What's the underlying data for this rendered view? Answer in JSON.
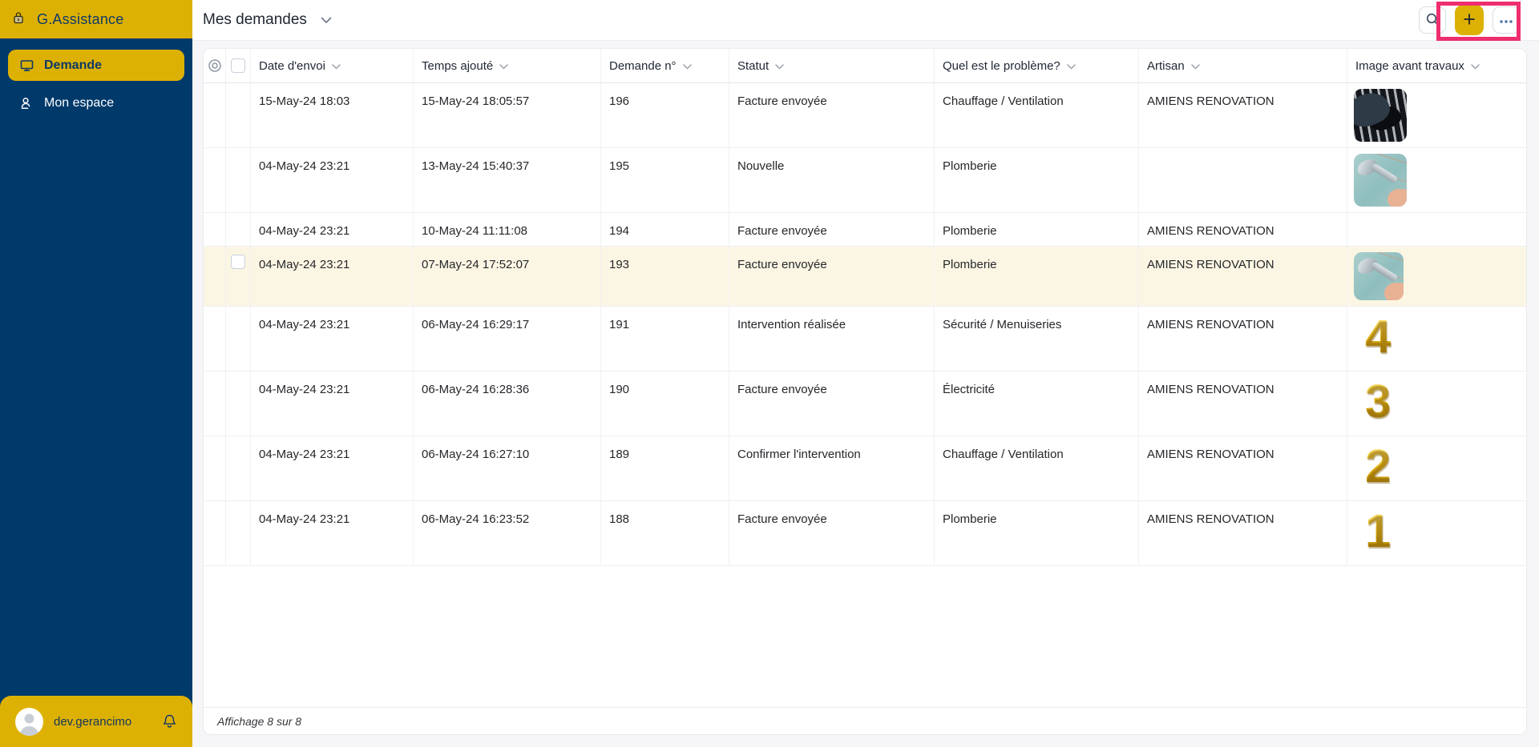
{
  "app": {
    "brand": "G.Assistance"
  },
  "colors": {
    "brand_yellow": "#DDB104",
    "sidebar_blue": "#003A6B",
    "annotation_pink": "#EE2E6E",
    "row_highlight": "#FBF6E3"
  },
  "sidebar": {
    "brand_icon": "padlock-icon",
    "items": [
      {
        "label": "Demande",
        "icon": "monitor-icon",
        "active": true
      },
      {
        "label": "Mon espace",
        "icon": "user-icon",
        "active": false
      }
    ],
    "user": {
      "name": "dev.gerancimo",
      "icons": [
        "avatar",
        "bell-icon"
      ]
    }
  },
  "topbar": {
    "title": "Mes demandes",
    "title_icon": "chevron-down-icon",
    "actions": [
      {
        "name": "search",
        "icon": "search-icon"
      },
      {
        "name": "add",
        "icon": "plus-icon"
      },
      {
        "name": "more",
        "icon": "ellipsis-icon"
      }
    ]
  },
  "annotation": {
    "shape": "highlight-rectangle",
    "color": "#EE2E6E"
  },
  "table": {
    "tools": {
      "watch_icon": "watch-all-icon",
      "select_all": "checkbox"
    },
    "columns": [
      {
        "label": "Date d'envoi",
        "sort_icon": "chevron-down-icon"
      },
      {
        "label": "Temps ajouté",
        "sort_icon": "chevron-down-icon"
      },
      {
        "label": "Demande n°",
        "sort_icon": "chevron-down-icon"
      },
      {
        "label": "Statut",
        "sort_icon": "chevron-down-icon"
      },
      {
        "label": "Quel est le problème?",
        "sort_icon": "chevron-down-icon"
      },
      {
        "label": "Artisan",
        "sort_icon": "chevron-down-icon"
      },
      {
        "label": "Image avant travaux",
        "sort_icon": "chevron-down-icon"
      }
    ],
    "rows": [
      {
        "date": "15-May-24 18:03",
        "time_added": "15-May-24 18:05:57",
        "number": "196",
        "status": "Facture envoyée",
        "problem": "Chauffage / Ventilation",
        "artisan": "AMIENS RENOVATION",
        "image": {
          "kind": "photo-radiator",
          "label": ""
        },
        "highlighted": false
      },
      {
        "date": "04-May-24 23:21",
        "time_added": "13-May-24 15:40:37",
        "number": "195",
        "status": "Nouvelle",
        "problem": "Plomberie",
        "artisan": "",
        "image": {
          "kind": "photo-shower",
          "label": ""
        },
        "highlighted": false
      },
      {
        "date": "04-May-24 23:21",
        "time_added": "10-May-24 11:11:08",
        "number": "194",
        "status": "Facture envoyée",
        "problem": "Plomberie",
        "artisan": "AMIENS RENOVATION",
        "image": {
          "kind": "none",
          "label": ""
        },
        "highlighted": false
      },
      {
        "date": "04-May-24 23:21",
        "time_added": "07-May-24 17:52:07",
        "number": "193",
        "status": "Facture envoyée",
        "problem": "Plomberie",
        "artisan": "AMIENS RENOVATION",
        "image": {
          "kind": "photo-shower",
          "label": ""
        },
        "highlighted": true
      },
      {
        "date": "04-May-24 23:21",
        "time_added": "06-May-24 16:29:17",
        "number": "191",
        "status": "Intervention réalisée",
        "problem": "Sécurité / Menuiseries",
        "artisan": "AMIENS RENOVATION",
        "image": {
          "kind": "gold-number",
          "label": "4"
        },
        "highlighted": false
      },
      {
        "date": "04-May-24 23:21",
        "time_added": "06-May-24 16:28:36",
        "number": "190",
        "status": "Facture envoyée",
        "problem": "Électricité",
        "artisan": "AMIENS RENOVATION",
        "image": {
          "kind": "gold-number",
          "label": "3"
        },
        "highlighted": false
      },
      {
        "date": "04-May-24 23:21",
        "time_added": "06-May-24 16:27:10",
        "number": "189",
        "status": "Confirmer l'intervention",
        "problem": "Chauffage / Ventilation",
        "artisan": "AMIENS RENOVATION",
        "image": {
          "kind": "gold-number",
          "label": "2"
        },
        "highlighted": false
      },
      {
        "date": "04-May-24 23:21",
        "time_added": "06-May-24 16:23:52",
        "number": "188",
        "status": "Facture envoyée",
        "problem": "Plomberie",
        "artisan": "AMIENS RENOVATION",
        "image": {
          "kind": "gold-number",
          "label": "1"
        },
        "highlighted": false
      }
    ],
    "footer": "Affichage 8 sur 8"
  }
}
